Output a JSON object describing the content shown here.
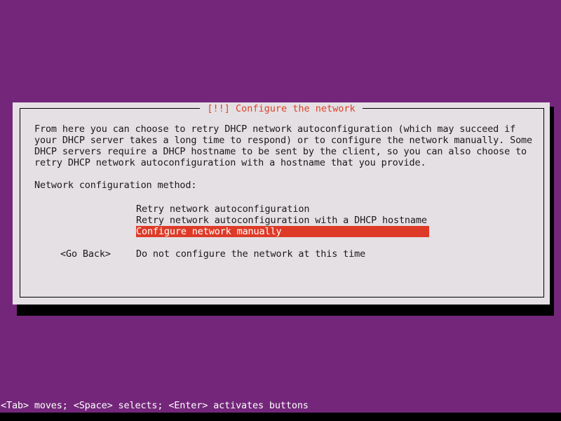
{
  "screen": {
    "background_color": "#74277a",
    "shadow_color": "#000000"
  },
  "dialog": {
    "title": "[!!] Configure the network",
    "title_color": "#dc4226",
    "background_color": "#e5e0e4",
    "border_color": "#000000",
    "body_paragraph_lines": [
      "From here you can choose to retry DHCP network autoconfiguration (which may succeed if",
      "your DHCP server takes a long time to respond) or to configure the network manually. Some",
      "DHCP servers require a DHCP hostname to be sent by the client, so you can also choose to",
      "retry DHCP network autoconfiguration with a hostname that you provide."
    ],
    "method_label": "Network configuration method:",
    "menu_items": [
      {
        "label": "Retry network autoconfiguration",
        "selected": false,
        "gap_before": false
      },
      {
        "label": "Retry network autoconfiguration with a DHCP hostname",
        "selected": false,
        "gap_before": false
      },
      {
        "label": "Configure network manually",
        "selected": true,
        "gap_before": false
      },
      {
        "label": "Do not configure the network at this time",
        "selected": false,
        "gap_before": true
      }
    ],
    "selection_color": "#dd3b28",
    "selection_text_color": "#ffffff",
    "go_back_button": "<Go Back>"
  },
  "status_bar": {
    "text": "<Tab> moves; <Space> selects; <Enter> activates buttons",
    "background_color": "#74277a",
    "text_color": "#ffffff"
  }
}
